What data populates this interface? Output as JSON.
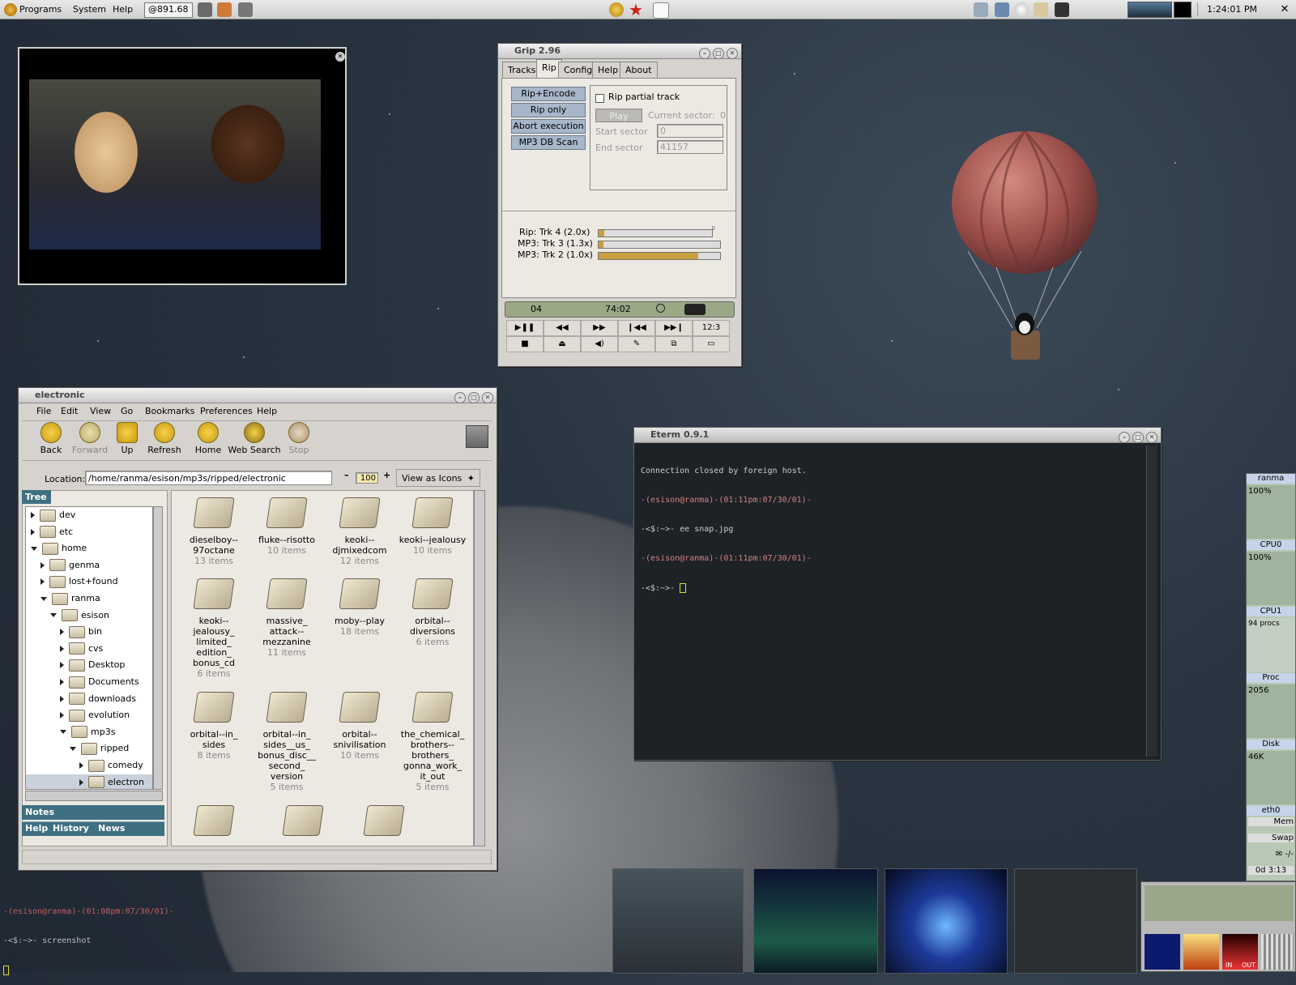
{
  "panel": {
    "menus": [
      "Programs",
      "System",
      "Help"
    ],
    "launcher_value": "@891.68",
    "clock": "1:24:01 PM"
  },
  "grip": {
    "title": "Grip 2.96",
    "tabs": [
      "Tracks",
      "Rip",
      "Config",
      "Help",
      "About"
    ],
    "buttons": [
      "Rip+Encode",
      "Rip only",
      "Abort execution",
      "MP3 DB Scan"
    ],
    "rip_partial_label": "Rip partial track",
    "play_label": "Play",
    "current_sector_label": "Current sector:",
    "current_sector_value": "0",
    "start_sector_label": "Start sector",
    "start_sector_value": "0",
    "end_sector_label": "End sector",
    "end_sector_value": "41157",
    "progress": [
      {
        "label": "Rip: Trk 4 (2.0x)",
        "fraction": 0.05
      },
      {
        "label": "MP3: Trk 3 (1.3x)",
        "fraction": 0.04
      },
      {
        "label": "MP3: Trk 2 (1.0x)",
        "fraction": 0.82
      }
    ],
    "track_num": "04",
    "track_time": "74:02",
    "counter_label": "12:3"
  },
  "nautilus": {
    "title": "electronic",
    "menus": [
      "File",
      "Edit",
      "View",
      "Go",
      "Bookmarks",
      "Preferences",
      "Help"
    ],
    "toolbar": [
      "Back",
      "Forward",
      "Up",
      "Refresh",
      "Home",
      "Web Search",
      "Stop"
    ],
    "location_label": "Location:",
    "location_value": "/home/ranma/esison/mp3s/ripped/electronic",
    "zoom_value": "100",
    "view_as": "View as Icons",
    "tree_tab": "Tree",
    "tree": [
      {
        "label": "dev",
        "depth": 1,
        "open": false
      },
      {
        "label": "etc",
        "depth": 1,
        "open": false
      },
      {
        "label": "home",
        "depth": 1,
        "open": true
      },
      {
        "label": "genma",
        "depth": 2,
        "open": false
      },
      {
        "label": "lost+found",
        "depth": 2,
        "open": false
      },
      {
        "label": "ranma",
        "depth": 2,
        "open": true
      },
      {
        "label": "esison",
        "depth": 3,
        "open": true
      },
      {
        "label": "bin",
        "depth": 4,
        "open": false
      },
      {
        "label": "cvs",
        "depth": 4,
        "open": false
      },
      {
        "label": "Desktop",
        "depth": 4,
        "open": false
      },
      {
        "label": "Documents",
        "depth": 4,
        "open": false
      },
      {
        "label": "downloads",
        "depth": 4,
        "open": false
      },
      {
        "label": "evolution",
        "depth": 4,
        "open": false
      },
      {
        "label": "mp3s",
        "depth": 4,
        "open": true
      },
      {
        "label": "ripped",
        "depth": 5,
        "open": true
      },
      {
        "label": "comedy",
        "depth": 6,
        "open": false
      },
      {
        "label": "electron",
        "depth": 6,
        "open": false
      }
    ],
    "side_tabs": [
      "Notes",
      "Help",
      "History",
      "News"
    ],
    "files": [
      {
        "name": "dieselboy--\n97octane",
        "count": "13 items"
      },
      {
        "name": "fluke--risotto",
        "count": "10 items"
      },
      {
        "name": "keoki--\ndjmixedcom",
        "count": "12 items"
      },
      {
        "name": "keoki--jealousy",
        "count": "10 items"
      },
      {
        "name": "keoki--\njealousy_\nlimited_\nedition_\nbonus_cd",
        "count": "6 items"
      },
      {
        "name": "massive_\nattack--\nmezzanine",
        "count": "11 items"
      },
      {
        "name": "moby--play",
        "count": "18 items"
      },
      {
        "name": "orbital--\ndiversions",
        "count": "6 items"
      },
      {
        "name": "orbital--in_\nsides",
        "count": "8 items"
      },
      {
        "name": "orbital--in_\nsides__us_\nbonus_disc__\nsecond_\nversion",
        "count": "5 items"
      },
      {
        "name": "orbital--\nsnivilisation",
        "count": "10 items"
      },
      {
        "name": "the_chemical_\nbrothers--\nbrothers_\ngonna_work_\nit_out",
        "count": "5 items"
      }
    ]
  },
  "eterm": {
    "title": "Eterm 0.9.1",
    "lines": [
      "Connection closed by foreign host.",
      "-(esison@ranma)-(01:11pm:07/30/01)-",
      "-<$:~>- ee snap.jpg",
      "-(esison@ranma)-(01:11pm:07/30/01)-",
      "-<$:~>- "
    ]
  },
  "desktop_term": {
    "lines": [
      "-(esison@ranma)-(01:08pm:07/30/01)-",
      "-<$:~>- screenshot"
    ]
  },
  "monitor": {
    "host": "ranma",
    "cpu0_pct": "100%",
    "cpu0_label": "CPU0",
    "cpu1_pct": "100%",
    "cpu1_label": "CPU1",
    "procs": "94 procs",
    "proc_label": "Proc",
    "proc_value": "2056",
    "disk_label": "Disk",
    "disk_value": "46K",
    "net_label": "eth0",
    "mem_label": "Mem",
    "swap_label": "Swap",
    "uptime": "0d 3:13"
  },
  "mixer": {
    "in_label": "IN",
    "out_label": "OUT"
  },
  "colors": {
    "accent": "#a7b6c9",
    "terminal_bg": "#1d2226",
    "prompt_red": "#b84040"
  }
}
